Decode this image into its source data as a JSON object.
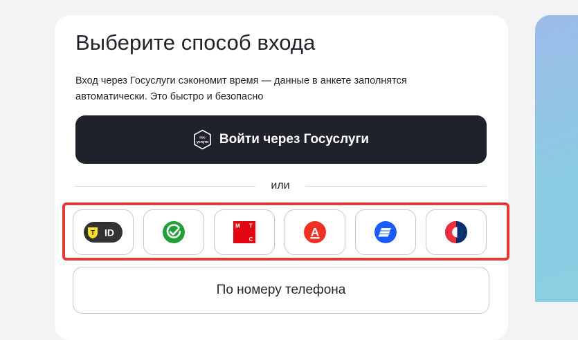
{
  "login": {
    "title": "Выберите способ входа",
    "description": "Вход через Госуслуги сэкономит время — данные в анкете заполнятся автоматически. Это быстро и безопасно",
    "gosuslugi_button": {
      "label": "Войти через Госуслуги",
      "logo_text_top": "гос",
      "logo_text_bottom": "услуги"
    },
    "divider_label": "или",
    "providers": [
      {
        "name": "T-ID",
        "icon": "t-id-icon",
        "text": "ID",
        "letter": "Т",
        "colors": {
          "bg": "#333333",
          "accent": "#ffdd2d"
        }
      },
      {
        "name": "Sber ID",
        "icon": "sber-icon",
        "colors": {
          "bg": "#21a038"
        }
      },
      {
        "name": "MTS ID",
        "icon": "mts-icon",
        "letters": [
          "М",
          "Т",
          "С"
        ],
        "colors": {
          "bg": "#e30611"
        }
      },
      {
        "name": "Alfa ID",
        "icon": "alfa-icon",
        "letter": "А",
        "colors": {
          "bg": "#ef3124"
        }
      },
      {
        "name": "VTB ID",
        "icon": "vtb-icon",
        "colors": {
          "bg": "#1a5cff"
        }
      },
      {
        "name": "Gazprombank ID",
        "icon": "gazprom-icon",
        "colors": {
          "red": "#ee2e3b",
          "blue": "#0a2d6e"
        }
      }
    ],
    "phone_button": {
      "label": "По номеру телефона"
    }
  },
  "colors": {
    "page_bg": "#f2f3f5",
    "card_bg": "#ffffff",
    "primary_dark": "#1f222b",
    "highlight": "#e53935"
  }
}
